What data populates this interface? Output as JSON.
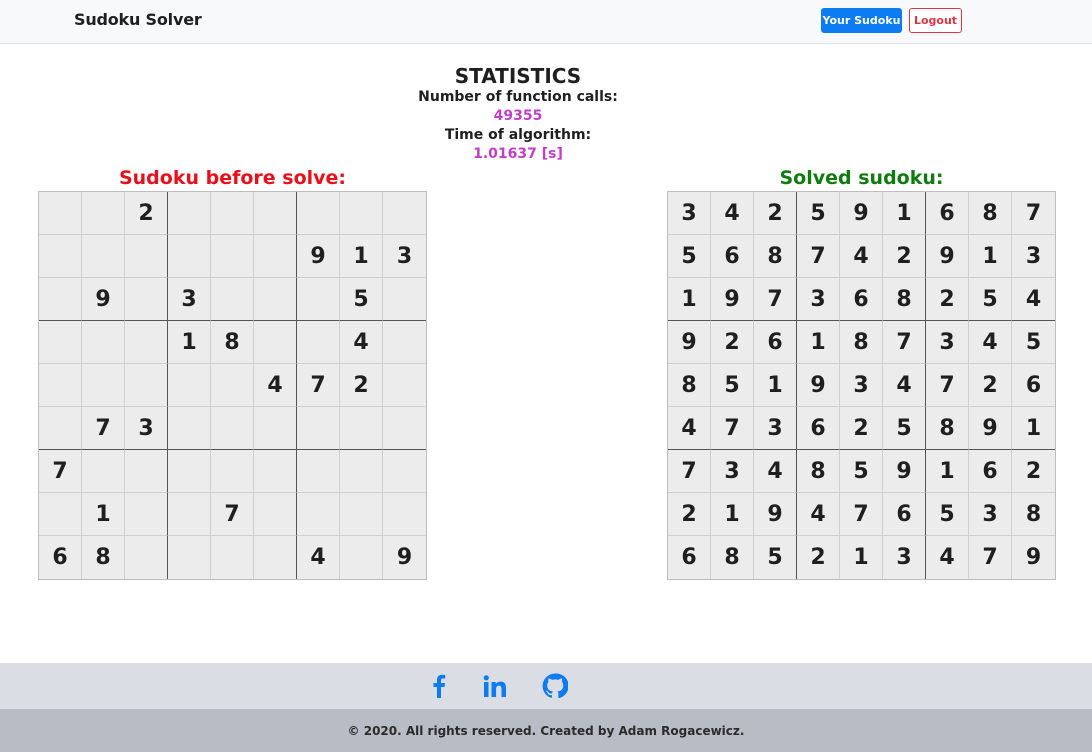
{
  "navbar": {
    "brand": "Sudoku Solver",
    "your_sudoku_button": "Your Sudoku",
    "logout_button": "Logout"
  },
  "statistics": {
    "title": "STATISTICS",
    "function_calls_label": "Number of function calls:",
    "function_calls_value": "49355",
    "time_label": "Time of algorithm:",
    "time_value": "1.01637 [s]"
  },
  "board_before": {
    "title": "Sudoku before solve:",
    "cells": [
      [
        "",
        "",
        "2",
        "",
        "",
        "",
        "",
        "",
        ""
      ],
      [
        "",
        "",
        "",
        "",
        "",
        "",
        "9",
        "1",
        "3"
      ],
      [
        "",
        "9",
        "",
        "3",
        "",
        "",
        "",
        "5",
        ""
      ],
      [
        "",
        "",
        "",
        "1",
        "8",
        "",
        "",
        "4",
        ""
      ],
      [
        "",
        "",
        "",
        "",
        "",
        "4",
        "7",
        "2",
        ""
      ],
      [
        "",
        "7",
        "3",
        "",
        "",
        "",
        "",
        "",
        ""
      ],
      [
        "7",
        "",
        "",
        "",
        "",
        "",
        "",
        "",
        ""
      ],
      [
        "",
        "1",
        "",
        "",
        "7",
        "",
        "",
        "",
        ""
      ],
      [
        "6",
        "8",
        "",
        "",
        "",
        "",
        "4",
        "",
        "9"
      ]
    ]
  },
  "board_solved": {
    "title": "Solved sudoku:",
    "cells": [
      [
        "3",
        "4",
        "2",
        "5",
        "9",
        "1",
        "6",
        "8",
        "7"
      ],
      [
        "5",
        "6",
        "8",
        "7",
        "4",
        "2",
        "9",
        "1",
        "3"
      ],
      [
        "1",
        "9",
        "7",
        "3",
        "6",
        "8",
        "2",
        "5",
        "4"
      ],
      [
        "9",
        "2",
        "6",
        "1",
        "8",
        "7",
        "3",
        "4",
        "5"
      ],
      [
        "8",
        "5",
        "1",
        "9",
        "3",
        "4",
        "7",
        "2",
        "6"
      ],
      [
        "4",
        "7",
        "3",
        "6",
        "2",
        "5",
        "8",
        "9",
        "1"
      ],
      [
        "7",
        "3",
        "4",
        "8",
        "5",
        "9",
        "1",
        "6",
        "2"
      ],
      [
        "2",
        "1",
        "9",
        "4",
        "7",
        "6",
        "5",
        "3",
        "8"
      ],
      [
        "6",
        "8",
        "5",
        "2",
        "1",
        "3",
        "4",
        "7",
        "9"
      ]
    ]
  },
  "footer": {
    "social_icons": [
      "facebook-icon",
      "linkedin-icon",
      "github-icon"
    ],
    "copyright": "© 2020. All rights reserved. Created by Adam Rogacewicz."
  },
  "colors": {
    "brand_primary": "#0d7cf2",
    "logout": "#dc3545",
    "stat_value": "#c13fc8",
    "before_title": "#e8101a",
    "solved_title": "#107c10"
  }
}
